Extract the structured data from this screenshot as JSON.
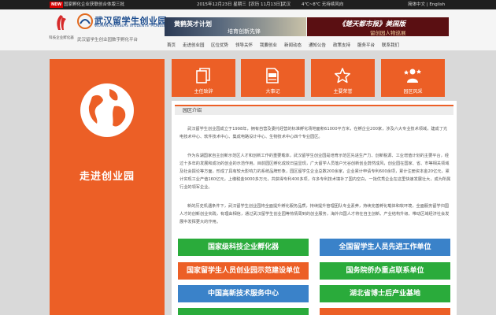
{
  "topbar": {
    "badge": "NEW",
    "news": "国家孵化企业获联创合体版三批",
    "date": "2015年12月23日 星期三【农历 11月13日】",
    "city": "武汉",
    "weather": "4℃~8℃ 无持续风向",
    "lang": "简体中文 | English"
  },
  "header": {
    "emblem_label": "科技企业孵化器",
    "logo_title": "武汉留学生创业园",
    "logo_sub": "WUHAN OVERSEAS STUDENTS' PIONEER PARK",
    "tagline": "武汉留学生创业园数字孵化平台",
    "banner1_line1": "黄鹤英才计划",
    "banner1_line2": "培育创新先锋",
    "banner2_line1": "《楚天都市报》美国版",
    "banner2_line2": "留创园人物巡展"
  },
  "nav": {
    "items": [
      "首页",
      "走进创业园",
      "区位优势",
      "领导关怀",
      "我要创业",
      "新闻动态",
      "通知公告",
      "政策支持",
      "服务平台",
      "联系我们"
    ]
  },
  "hero": {
    "title": "走进创业园"
  },
  "tiles": [
    {
      "label": "主任致辞",
      "icon": "document-copy-icon"
    },
    {
      "label": "大事记",
      "icon": "case-file-icon"
    },
    {
      "label": "主要荣誉",
      "icon": "star-icon"
    },
    {
      "label": "园区风采",
      "icon": "person-stars-icon"
    }
  ],
  "panel": {
    "heading": "园区介绍",
    "paragraphs": [
      "武汉留学生创业园成立于1998年，拥有自营及委托经营的标准孵化场地面积61000平方米，在孵企业200家，涉及六大专业技术领域，建成了光电技术中心、软件技术中心、集成电路设计中心、生物技术中心四个专业园区。",
      "作为东湖国家自主创新示范区人才和创新工作的重要载体，武汉留学生创业园是培育示范区先进生产力、创新税源、工业增值计划的主要平台，经过十多年的发展和成功的创业的示范作用，目前园区孵化成效日益显现，广大留学人员落户光谷创新创业蔚然成风，创业园在国家、省、市等相关领域及社会舆论等方面，形成了具有较大影响力的系统品牌形象，园区留学生企业总数200余家，企业累计申请专利600余项，累计注册资本金20亿元，累计实现工业产值160亿元，上缴税金9000多万元，共获得专利400多项，许多专利技术填补了国内空白，一批优秀企业在这里快速发展壮大，成为所属行业的领军企业。",
      "新的历史机遇条件下，武汉留学生创业园将全面提升孵化服务品质，持续提升管理团队专业素养，持续完善孵化载体和软环境，全面服务留学归国人才的创新创业实践，有理由相信，通过武汉留学生创业园等热情周到的创业服务，海外归国人才将在自主创新、产业结构升级、带动区域经济社会发展中发挥更大的作用。"
    ]
  },
  "buttons": [
    {
      "label": "国家级科技企业孵化器",
      "color": "#2aab3b"
    },
    {
      "label": "全国留学生人员先进工作单位",
      "color": "#3a82c9"
    },
    {
      "label": "国家留学生人员创业园示范建设单位",
      "color": "#ec5f26"
    },
    {
      "label": "国务院侨办重点联系单位",
      "color": "#2aab3b"
    },
    {
      "label": "中国高新技术服务中心",
      "color": "#3a82c9"
    },
    {
      "label": "湖北省博士后产业基地",
      "color": "#2aab3b"
    },
    {
      "label": "",
      "color": "#2aab3b"
    },
    {
      "label": "",
      "color": "#ec5f26"
    }
  ]
}
